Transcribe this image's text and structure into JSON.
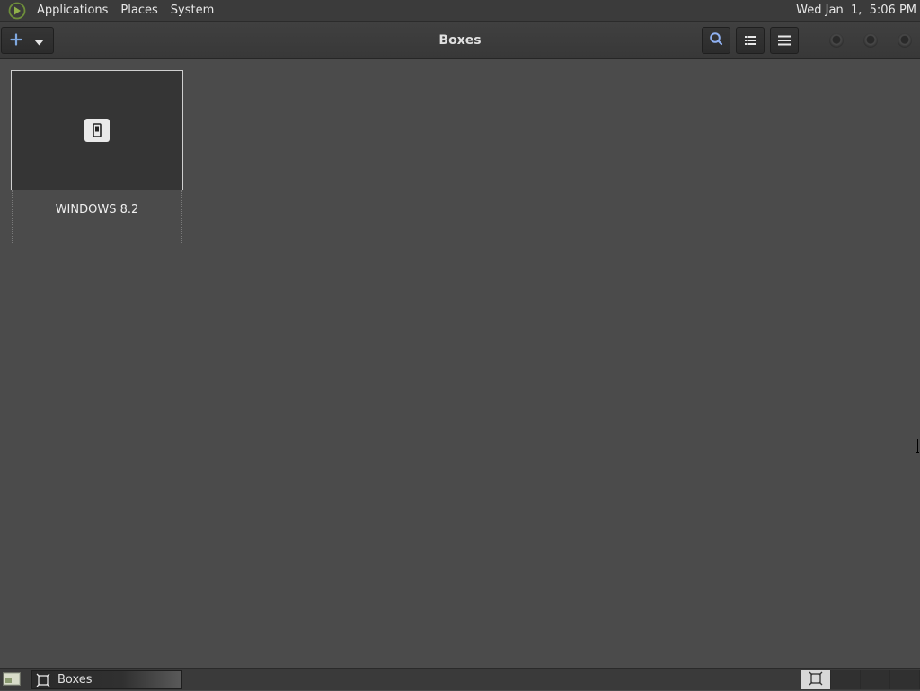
{
  "top_panel": {
    "menus": [
      "Applications",
      "Places",
      "System"
    ],
    "clock": "Wed Jan  1,  5:06 PM"
  },
  "headerbar": {
    "title": "Boxes",
    "buttons": {
      "new": "new-box-icon",
      "dropdown": "chevron-down-icon",
      "search": "search-icon",
      "selection": "list-icon",
      "menu": "hamburger-menu-icon"
    }
  },
  "boxes": [
    {
      "name": "WINDOWS 8.2",
      "icon": "vm-placeholder-icon"
    }
  ],
  "bottom_panel": {
    "task_label": "Boxes",
    "workspaces": 4,
    "active_workspace": 1
  },
  "colors": {
    "background": "#4b4b4b",
    "panel": "#3b3b3b",
    "accent_blue": "#7fa8e0"
  }
}
